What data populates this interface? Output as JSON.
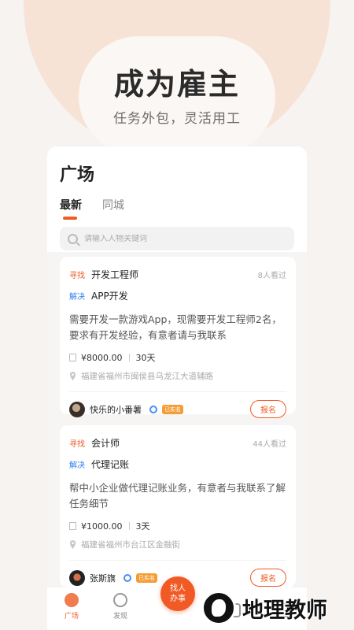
{
  "hero": {
    "title": "成为雇主",
    "subtitle": "任务外包，灵活用工"
  },
  "panel": {
    "title": "广场",
    "tabs": [
      {
        "label": "最新",
        "active": true
      },
      {
        "label": "同城",
        "active": false
      }
    ],
    "search": {
      "placeholder": "请输入人物关键词"
    }
  },
  "cards": [
    {
      "tag_find": "寻找",
      "role": "开发工程师",
      "views": "8人看过",
      "tag_solve": "解决",
      "task": "APP开发",
      "description": "需要开发一款游戏App，现需要开发工程师2名，要求有开发经验，有意者请与我联系",
      "price": "¥8000.00",
      "duration": "30天",
      "location": "福建省福州市闽侯县乌龙江大道辅路",
      "user": "快乐的小番薯",
      "verified_badge": "已实名",
      "action": "报名"
    },
    {
      "tag_find": "寻找",
      "role": "会计师",
      "views": "44人看过",
      "tag_solve": "解决",
      "task": "代理记账",
      "description": "帮中小企业做代理记账业务，有意者与我联系了解任务细节",
      "price": "¥1000.00",
      "duration": "3天",
      "location": "福建省福州市台江区金融街",
      "user": "张斯旗",
      "verified_badge": "已实名",
      "action": "报名"
    }
  ],
  "tabbar": {
    "items": [
      {
        "label": "广场",
        "icon": "planet-icon",
        "active": true
      },
      {
        "label": "发现",
        "icon": "discover-icon",
        "active": false
      }
    ],
    "center_button": {
      "line1": "找人",
      "line2": "办事"
    }
  },
  "watermark": {
    "text": "地理教师",
    "icon": "globe-logo-icon"
  },
  "colors": {
    "accent": "#f15a24",
    "blue": "#2d7ef3",
    "badge": "#f59c34"
  }
}
